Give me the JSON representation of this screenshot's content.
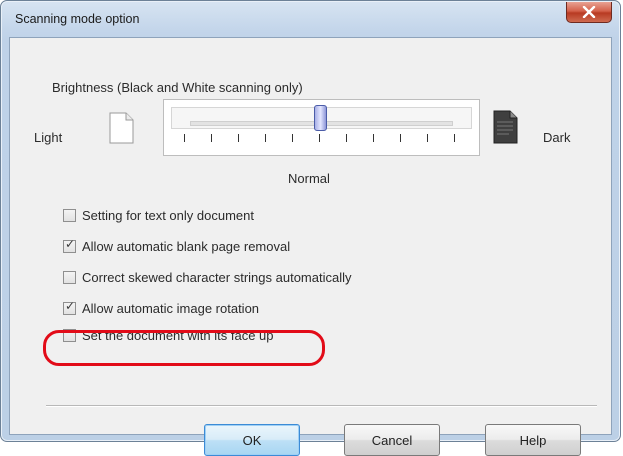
{
  "dialog": {
    "title": "Scanning mode option",
    "close_icon": "close-x-icon",
    "brightness": {
      "group_label": "Brightness (Black and White scanning only)",
      "light_label": "Light",
      "dark_label": "Dark",
      "normal_label": "Normal",
      "light_icon": "blank-page-icon",
      "dark_icon": "dark-page-icon",
      "slider_position": "Normal",
      "tick_count": 11
    },
    "options": [
      {
        "label": "Setting for text only document",
        "checked": false
      },
      {
        "label": "Allow automatic blank page removal",
        "checked": true
      },
      {
        "label": "Correct skewed character strings automatically",
        "checked": false
      },
      {
        "label": "Allow automatic image rotation",
        "checked": true,
        "highlighted": true
      },
      {
        "label": "Set the document with its face up",
        "checked": false
      }
    ],
    "buttons": {
      "ok": "OK",
      "cancel": "Cancel",
      "help": "Help"
    },
    "colors": {
      "highlight": "#e20b18",
      "close_button": "#c94a33",
      "frame": "#bcd0e6"
    }
  }
}
